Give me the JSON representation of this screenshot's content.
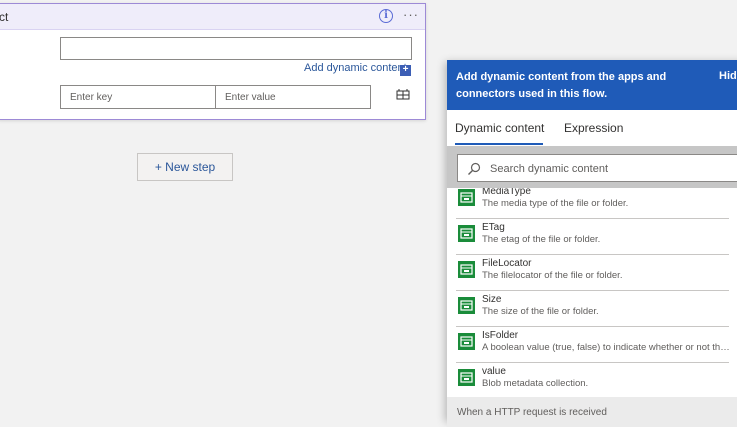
{
  "card": {
    "title": "ct",
    "add_dynamic_label": "Add dynamic content",
    "key_placeholder": "Enter key",
    "value_placeholder": "Enter value",
    "info_icon": "info-icon",
    "more_icon": "more-icon"
  },
  "new_step": {
    "label": "+ New step"
  },
  "panel": {
    "header_text": "Add dynamic content from the apps and connectors used in this flow.",
    "hide_label": "Hid",
    "tabs": [
      {
        "label": "Dynamic content",
        "active": true
      },
      {
        "label": "Expression",
        "active": false
      }
    ],
    "search_placeholder": "Search dynamic content",
    "items": [
      {
        "name": "MediaType",
        "desc": "The media type of the file or folder."
      },
      {
        "name": "ETag",
        "desc": "The etag of the file or folder."
      },
      {
        "name": "FileLocator",
        "desc": "The filelocator of the file or folder."
      },
      {
        "name": "Size",
        "desc": "The size of the file or folder."
      },
      {
        "name": "IsFolder",
        "desc": "A boolean value (true, false) to indicate whether or not the blob is a folder."
      },
      {
        "name": "value",
        "desc": "Blob metadata collection."
      }
    ],
    "footer_text": "When a HTTP request is received"
  },
  "colors": {
    "accent": "#1f5bb8",
    "card_border": "#9d8ad6",
    "item_icon": "#1a8c3a",
    "link": "#2b579a"
  }
}
